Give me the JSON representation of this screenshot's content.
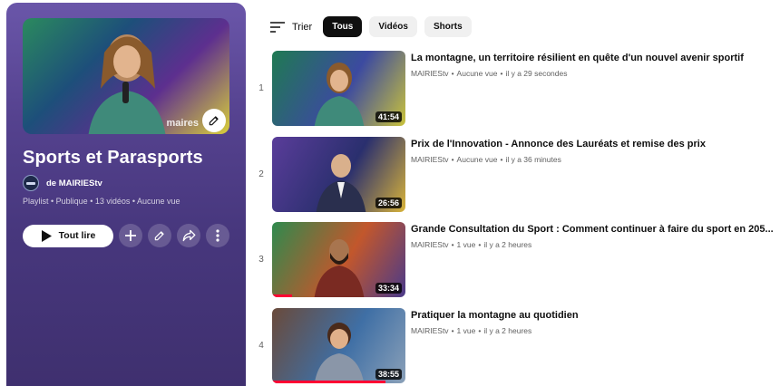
{
  "playlist": {
    "title": "Sports et Parasports",
    "channel_prefix": "de",
    "channel": "MAIRIEStv",
    "meta": "Playlist • Publique • 13 vidéos • Aucune vue",
    "play_all_label": "Tout lire",
    "cover_mark": "maires"
  },
  "sort": {
    "label": "Trier"
  },
  "filters": [
    {
      "label": "Tous",
      "active": true
    },
    {
      "label": "Vidéos",
      "active": false
    },
    {
      "label": "Shorts",
      "active": false
    }
  ],
  "videos": [
    {
      "index": "1",
      "title": "La montagne, un territoire résilient en quête d'un nouvel avenir sportif",
      "channel": "MAIRIEStv",
      "views": "Aucune vue",
      "age": "il y a 29 secondes",
      "duration": "41:54",
      "colors": [
        "#1f7a52",
        "#3c4aa0",
        "#c9c23b"
      ]
    },
    {
      "index": "2",
      "title": "Prix de l'Innovation - Annonce des Lauréats et remise des prix",
      "channel": "MAIRIEStv",
      "views": "Aucune vue",
      "age": "il y a 36 minutes",
      "duration": "26:56",
      "colors": [
        "#5a3d9a",
        "#2a2f6e",
        "#d8b33a"
      ]
    },
    {
      "index": "3",
      "title": "Grande Consultation du Sport : Comment continuer à faire du sport en 205...",
      "channel": "MAIRIEStv",
      "views": "1 vue",
      "age": "il y a 2 heures",
      "duration": "33:34",
      "colors": [
        "#2e8a4e",
        "#c2572c",
        "#4a3a8a"
      ]
    },
    {
      "index": "4",
      "title": "Pratiquer la montagne au quotidien",
      "channel": "MAIRIEStv",
      "views": "1 vue",
      "age": "il y a 2 heures",
      "duration": "38:55",
      "colors": [
        "#6a4a3a",
        "#3f6fa5",
        "#8aa0b8"
      ]
    }
  ],
  "progress": {
    "video_3_watched_fraction": 0.15,
    "video_4_watched_fraction": 0.85
  }
}
